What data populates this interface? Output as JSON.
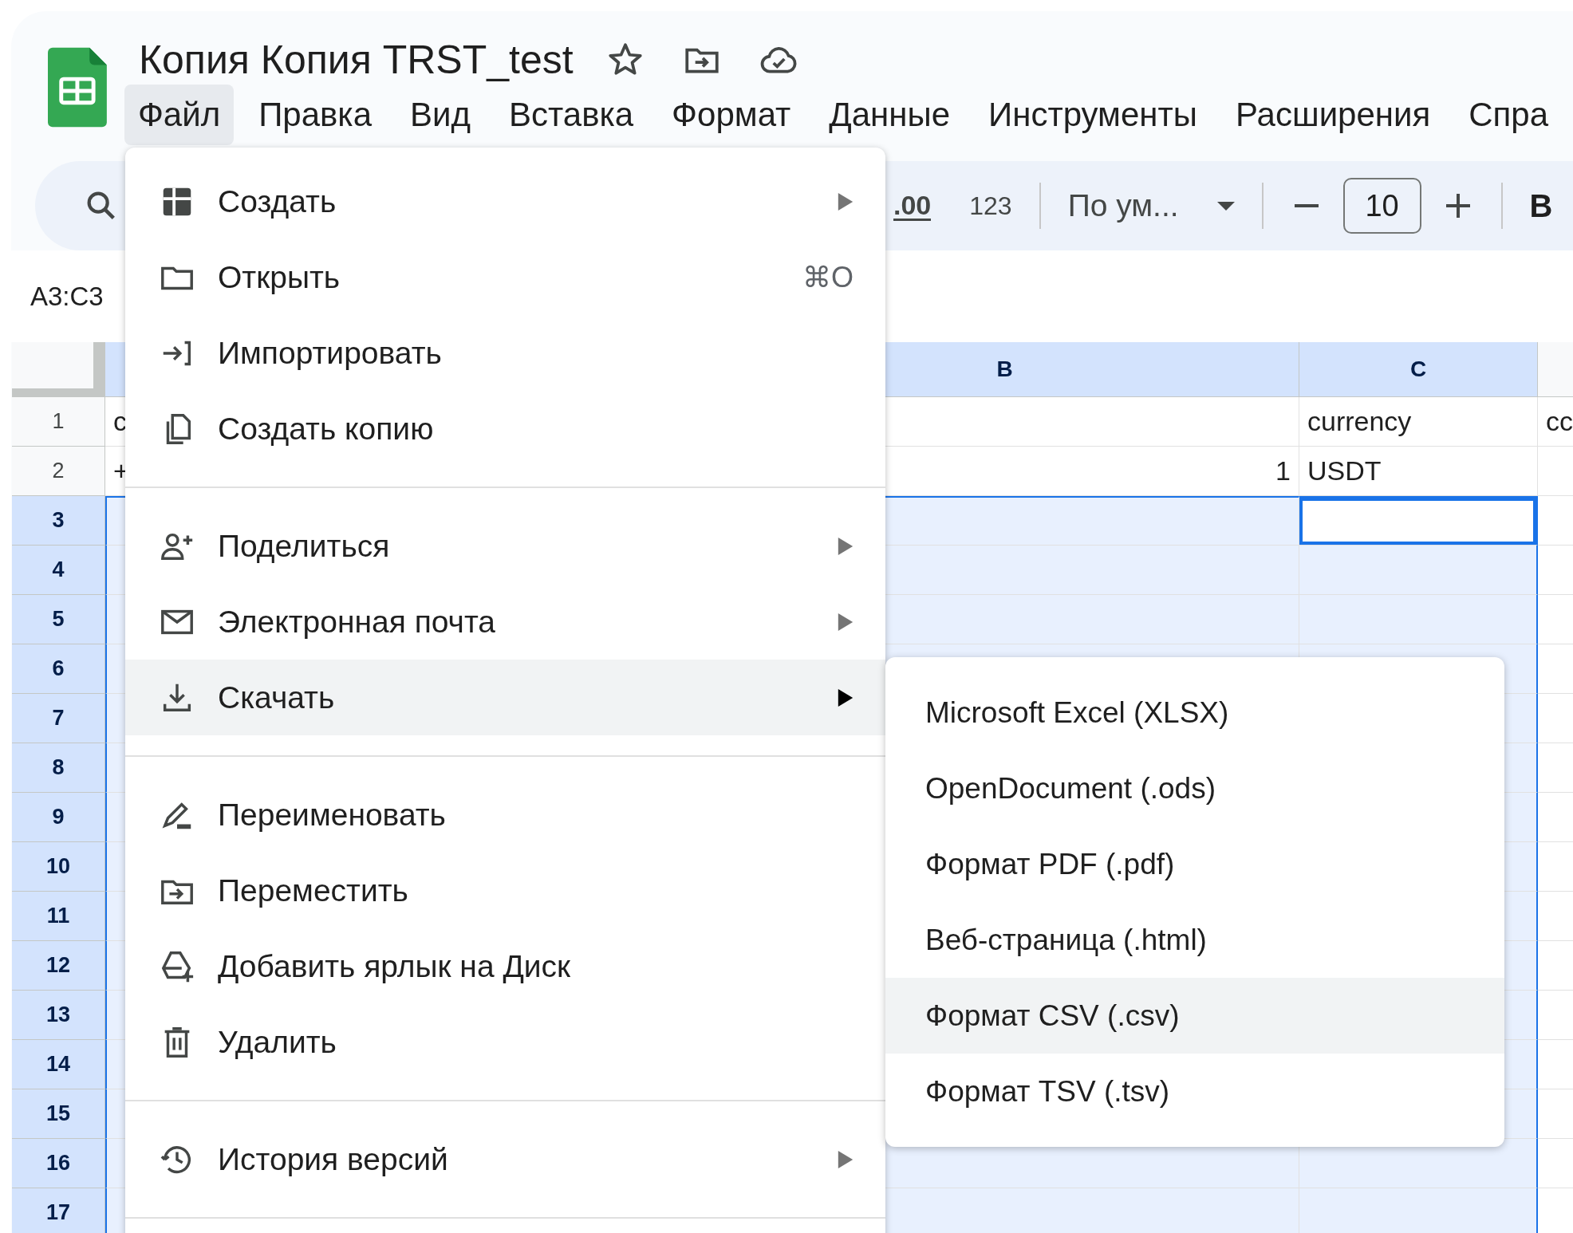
{
  "document": {
    "title": "Копия Копия TRST_test"
  },
  "menu_bar": [
    {
      "label": "Файл",
      "selected": true
    },
    {
      "label": "Правка",
      "selected": false
    },
    {
      "label": "Вид",
      "selected": false
    },
    {
      "label": "Вставка",
      "selected": false
    },
    {
      "label": "Формат",
      "selected": false
    },
    {
      "label": "Данные",
      "selected": false
    },
    {
      "label": "Инструменты",
      "selected": false
    },
    {
      "label": "Расширения",
      "selected": false
    },
    {
      "label": "Спра",
      "selected": false
    }
  ],
  "toolbar": {
    "decimal_label": ".00",
    "number_format": "123",
    "font": "По ум...",
    "font_size": "10",
    "bold_label": "B"
  },
  "name_box": "A3:C3",
  "grid": {
    "columns": [
      {
        "selected": true
      },
      {
        "label": "B",
        "selected": true
      },
      {
        "label": "C",
        "selected": true
      },
      {
        "selected": false
      }
    ],
    "rows": [
      {
        "number": "1",
        "selected": false,
        "cells": [
          "c",
          "",
          "currency",
          "cc"
        ]
      },
      {
        "number": "2",
        "selected": false,
        "cells": [
          "+",
          "1",
          "USDT",
          ""
        ]
      },
      {
        "number": "3",
        "selected": true,
        "cells": [
          "",
          "",
          "",
          ""
        ]
      },
      {
        "number": "4",
        "selected": true,
        "cells": [
          "",
          "",
          "",
          ""
        ]
      },
      {
        "number": "5",
        "selected": true,
        "cells": [
          "",
          "",
          "",
          ""
        ]
      },
      {
        "number": "6",
        "selected": true,
        "cells": [
          "",
          "",
          "",
          ""
        ]
      },
      {
        "number": "7",
        "selected": true,
        "cells": [
          "",
          "",
          "",
          ""
        ]
      },
      {
        "number": "8",
        "selected": true,
        "cells": [
          "",
          "",
          "",
          ""
        ]
      },
      {
        "number": "9",
        "selected": true,
        "cells": [
          "",
          "",
          "",
          ""
        ]
      },
      {
        "number": "10",
        "selected": true,
        "cells": [
          "",
          "",
          "",
          ""
        ]
      },
      {
        "number": "11",
        "selected": true,
        "cells": [
          "",
          "",
          "",
          ""
        ]
      },
      {
        "number": "12",
        "selected": true,
        "cells": [
          "",
          "",
          "",
          ""
        ]
      },
      {
        "number": "13",
        "selected": true,
        "cells": [
          "",
          "",
          "",
          ""
        ]
      },
      {
        "number": "14",
        "selected": true,
        "cells": [
          "",
          "",
          "",
          ""
        ]
      },
      {
        "number": "15",
        "selected": true,
        "cells": [
          "",
          "",
          "",
          ""
        ]
      },
      {
        "number": "16",
        "selected": true,
        "cells": [
          "",
          "",
          "",
          ""
        ]
      },
      {
        "number": "17",
        "selected": true,
        "cells": [
          "",
          "",
          "",
          ""
        ]
      }
    ]
  },
  "file_menu": {
    "sections": [
      [
        {
          "label": "Создать",
          "submenu": true,
          "selected": false
        },
        {
          "label": "Открыть",
          "shortcut": "⌘O",
          "submenu": false,
          "selected": false
        },
        {
          "label": "Импортировать",
          "submenu": false,
          "selected": false
        },
        {
          "label": "Создать копию",
          "submenu": false,
          "selected": false
        }
      ],
      [
        {
          "label": "Поделиться",
          "submenu": true,
          "selected": false
        },
        {
          "label": "Электронная почта",
          "submenu": true,
          "selected": false
        },
        {
          "label": "Скачать",
          "submenu": true,
          "selected": true
        }
      ],
      [
        {
          "label": "Переименовать",
          "submenu": false,
          "selected": false
        },
        {
          "label": "Переместить",
          "submenu": false,
          "selected": false
        },
        {
          "label": "Добавить ярлык на Диск",
          "submenu": false,
          "selected": false
        },
        {
          "label": "Удалить",
          "submenu": false,
          "selected": false
        }
      ],
      [
        {
          "label": "История версий",
          "submenu": true,
          "selected": false
        }
      ]
    ]
  },
  "download_submenu": [
    {
      "label": "Microsoft Excel (XLSX)",
      "selected": false
    },
    {
      "label": "OpenDocument (.ods)",
      "selected": false
    },
    {
      "label": "Формат PDF (.pdf)",
      "selected": false
    },
    {
      "label": "Веб-страница (.html)",
      "selected": false
    },
    {
      "label": "Формат CSV (.csv)",
      "selected": true
    },
    {
      "label": "Формат TSV (.tsv)",
      "selected": false
    }
  ]
}
